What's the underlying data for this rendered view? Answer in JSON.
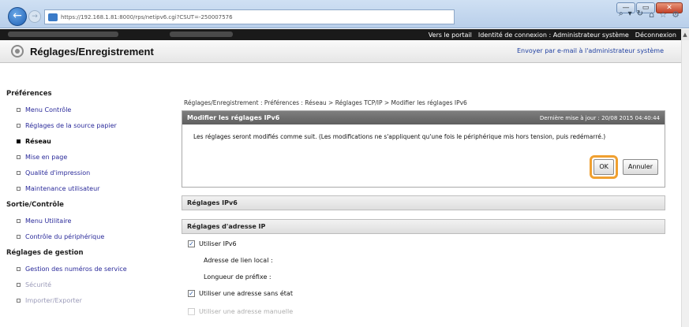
{
  "browser": {
    "url": "https://192.168.1.81:8000/rps/netipv6.cgi?CSUT=-250007576",
    "search_icon": "search-icon",
    "window_controls": {
      "minimize": "—",
      "maximize": "▭",
      "close": "✕"
    }
  },
  "portal": {
    "links": [
      "Vers le portail",
      "Identité de connexion : Administrateur système",
      "Déconnexion"
    ]
  },
  "header": {
    "title": "Réglages/Enregistrement",
    "email_link": "Envoyer par e-mail à l'administrateur système"
  },
  "sidebar": {
    "sections": [
      {
        "label": "Préférences",
        "items": [
          {
            "label": "Menu Contrôle",
            "active": false
          },
          {
            "label": "Réglages de la source papier",
            "active": false
          },
          {
            "label": "Réseau",
            "active": true
          },
          {
            "label": "Mise en page",
            "active": false
          },
          {
            "label": "Qualité d'impression",
            "active": false
          },
          {
            "label": "Maintenance utilisateur",
            "active": false
          }
        ]
      },
      {
        "label": "Sortie/Contrôle",
        "items": [
          {
            "label": "Menu Utilitaire",
            "active": false
          },
          {
            "label": "Contrôle du périphérique",
            "active": false
          }
        ]
      },
      {
        "label": "Réglages de gestion",
        "items": [
          {
            "label": "Gestion des numéros de service",
            "active": false
          },
          {
            "label": "Sécurité",
            "active": false
          },
          {
            "label": "Importer/Exporter",
            "active": false
          }
        ]
      }
    ]
  },
  "main": {
    "breadcrumb": "Réglages/Enregistrement : Préférences : Réseau > Réglages TCP/IP > Modifier les réglages IPv6",
    "dialog": {
      "title": "Modifier les réglages IPv6",
      "last_update": "Dernière mise à jour : 20/08 2015 04:40:44",
      "message": "Les réglages seront modifiés comme suit. (Les modifications ne s'appliquent qu'une fois le périphérique mis hors tension, puis redémarré.)",
      "ok_label": "OK",
      "cancel_label": "Annuler"
    },
    "ipv6_section": "Réglages IPv6",
    "address_section": "Réglages d'adresse IP",
    "fields": {
      "use_ipv6": "Utiliser IPv6",
      "link_local": "Adresse de lien local :",
      "prefix_length": "Longueur de préfixe :",
      "stateless": "Utiliser une adresse sans état",
      "manual": "Utiliser une adresse manuelle"
    }
  }
}
